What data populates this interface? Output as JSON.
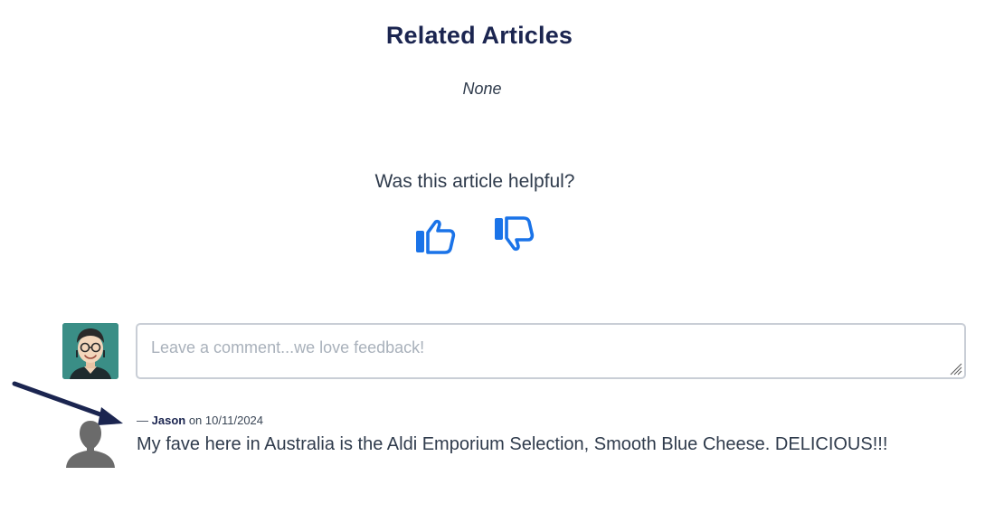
{
  "related": {
    "title": "Related Articles",
    "none_text": "None"
  },
  "feedback": {
    "question": "Was this article helpful?",
    "thumbs_up_icon": "thumbs-up-icon",
    "thumbs_down_icon": "thumbs-down-icon",
    "accent_color": "#1a73e8"
  },
  "comment_form": {
    "placeholder": "Leave a comment...we love feedback!",
    "value": ""
  },
  "comments": [
    {
      "dash": "—",
      "author": "Jason",
      "on_word": "on",
      "date": "10/11/2024",
      "text": "My fave here in Australia is the Aldi Emporium Selection, Smooth Blue Cheese. DELICIOUS!!!"
    }
  ],
  "colors": {
    "heading": "#1b2550",
    "body_text": "#2f3b4c",
    "arrow": "#1b2550",
    "avatar_bg": "#3a8e86",
    "placeholder_avatar": "#6b6b6b"
  }
}
